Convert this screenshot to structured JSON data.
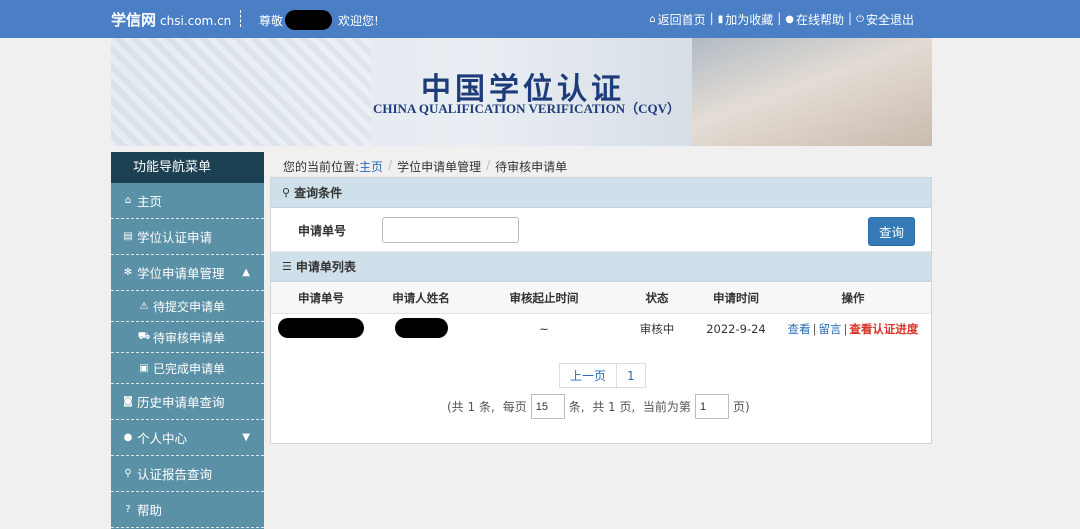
{
  "topbar": {
    "logo": "学信网",
    "domain": "chsi.com.cn",
    "greeting_prefix": "尊敬",
    "greeting_suffix": "欢迎您!",
    "links": [
      {
        "icon": "home-icon",
        "label": "返回首页"
      },
      {
        "icon": "bookmark-icon",
        "label": "加为收藏"
      },
      {
        "icon": "help-icon",
        "label": "在线帮助"
      },
      {
        "icon": "power-icon",
        "label": "安全退出"
      }
    ]
  },
  "banner": {
    "title": "中国学位认证",
    "subtitle": "CHINA QUALIFICATION VERIFICATION（CQV）"
  },
  "sidebar": {
    "header": "功能导航菜单",
    "items": [
      {
        "icon": "home-icon",
        "label": "主页"
      },
      {
        "icon": "document-icon",
        "label": "学位认证申请"
      },
      {
        "icon": "gear-icon",
        "label": "学位申请单管理",
        "expanded": true
      },
      {
        "icon": "warning-icon",
        "label": "待提交申请单"
      },
      {
        "icon": "cart-icon",
        "label": "待审核申请单"
      },
      {
        "icon": "briefcase-icon",
        "label": "已完成申请单"
      },
      {
        "icon": "camera-icon",
        "label": "历史申请单查询"
      },
      {
        "icon": "user-icon",
        "label": "个人中心",
        "expanded": false
      },
      {
        "icon": "search-icon",
        "label": "认证报告查询"
      },
      {
        "icon": "help-icon",
        "label": "帮助"
      }
    ]
  },
  "breadcrumb": {
    "prefix": "您的当前位置:",
    "home": "主页",
    "level2": "学位申请单管理",
    "level3": "待审核申请单"
  },
  "query": {
    "section_title": "查询条件",
    "field_label": "申请单号",
    "field_value": "",
    "button": "查询"
  },
  "list": {
    "section_title": "申请单列表",
    "columns": [
      "申请单号",
      "申请人姓名",
      "审核起止时间",
      "状态",
      "申请时间",
      "操作"
    ],
    "rows": [
      {
        "period": "~",
        "status": "审核中",
        "date": "2022-9-24",
        "op_view": "查看",
        "op_message": "留言",
        "op_progress": "查看认证进度"
      }
    ]
  },
  "pagination": {
    "prev": "上一页",
    "page": "1",
    "info_total": "(共 1 条,",
    "info_per": "每页",
    "per_page": "15",
    "info_mid": "条,  共 1 页,  当前为第",
    "current": "1",
    "info_end": "页)"
  },
  "colors": {
    "topbar": "#4a7fc6",
    "sidebar": "#5b91a6",
    "sidebar_header": "#1b4052",
    "section_head": "#cfe0ea",
    "primary_button": "#337ab7",
    "link": "#2a6db5",
    "danger": "#d9342b"
  }
}
